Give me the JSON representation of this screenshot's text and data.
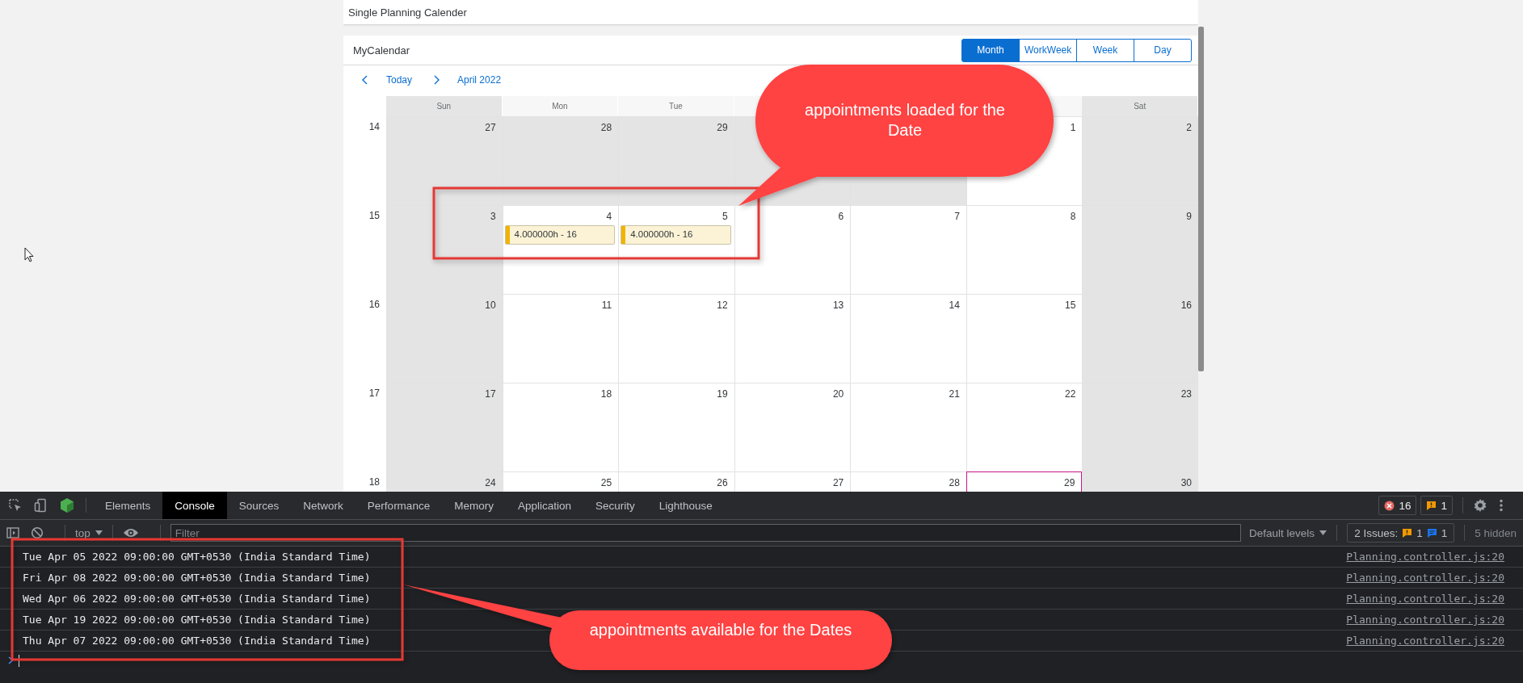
{
  "page_title": "Single Planning Calender",
  "calendar": {
    "title": "MyCalendar",
    "views": [
      {
        "label": "Month",
        "selected": true
      },
      {
        "label": "WorkWeek",
        "selected": false
      },
      {
        "label": "Week",
        "selected": false
      },
      {
        "label": "Day",
        "selected": false
      }
    ],
    "nav": {
      "today": "Today",
      "period": "April 2022"
    },
    "day_headers": [
      {
        "label": "Sun",
        "weekend": true
      },
      {
        "label": "Mon",
        "weekend": false
      },
      {
        "label": "Tue",
        "weekend": false
      },
      {
        "label": "Sat",
        "weekend": true
      }
    ],
    "weeks": [
      {
        "number": "14",
        "days": [
          {
            "day": "27",
            "muted": true,
            "today": false
          },
          {
            "day": "28",
            "muted": true,
            "today": false
          },
          {
            "day": "29",
            "muted": true,
            "today": false
          },
          {
            "muted": true,
            "today": false
          },
          {
            "muted": true,
            "today": false
          },
          {
            "day": "1",
            "muted": false,
            "today": false
          },
          {
            "day": "2",
            "muted": true,
            "today": false
          }
        ]
      },
      {
        "number": "15",
        "days": [
          {
            "day": "3",
            "muted": true,
            "today": false
          },
          {
            "day": "4",
            "muted": false,
            "today": false,
            "appointments": [
              {
                "title": "4.000000h - 16",
                "color": "#f0b400"
              }
            ]
          },
          {
            "day": "5",
            "muted": false,
            "today": false,
            "appointments": [
              {
                "title": "4.000000h - 16",
                "color": "#f0b400"
              }
            ]
          },
          {
            "day": "6",
            "muted": false,
            "today": false
          },
          {
            "day": "7",
            "muted": false,
            "today": false
          },
          {
            "day": "8",
            "muted": false,
            "today": false
          },
          {
            "day": "9",
            "muted": true,
            "today": false
          }
        ]
      },
      {
        "number": "16",
        "days": [
          {
            "day": "10",
            "muted": true,
            "today": false
          },
          {
            "day": "11",
            "muted": false,
            "today": false
          },
          {
            "day": "12",
            "muted": false,
            "today": false
          },
          {
            "day": "13",
            "muted": false,
            "today": false
          },
          {
            "day": "14",
            "muted": false,
            "today": false
          },
          {
            "day": "15",
            "muted": false,
            "today": false
          },
          {
            "day": "16",
            "muted": true,
            "today": false
          }
        ]
      },
      {
        "number": "17",
        "days": [
          {
            "day": "17",
            "muted": true,
            "today": false
          },
          {
            "day": "18",
            "muted": false,
            "today": false
          },
          {
            "day": "19",
            "muted": false,
            "today": false
          },
          {
            "day": "20",
            "muted": false,
            "today": false
          },
          {
            "day": "21",
            "muted": false,
            "today": false
          },
          {
            "day": "22",
            "muted": false,
            "today": false
          },
          {
            "day": "23",
            "muted": true,
            "today": false
          }
        ]
      },
      {
        "number": "18",
        "days": [
          {
            "day": "24",
            "muted": true,
            "today": false
          },
          {
            "day": "25",
            "muted": false,
            "today": false
          },
          {
            "day": "26",
            "muted": false,
            "today": false
          },
          {
            "day": "27",
            "muted": false,
            "today": false
          },
          {
            "day": "28",
            "muted": false,
            "today": false
          },
          {
            "day": "29",
            "muted": false,
            "today": true
          },
          {
            "day": "30",
            "muted": true,
            "today": false
          }
        ]
      }
    ]
  },
  "callouts": [
    {
      "text": "appointments loaded for the Date"
    },
    {
      "text": "appointments available for the Dates"
    }
  ],
  "devtools": {
    "tabs": [
      {
        "label": "Elements",
        "selected": false
      },
      {
        "label": "Console",
        "selected": true
      },
      {
        "label": "Sources",
        "selected": false
      },
      {
        "label": "Network",
        "selected": false
      },
      {
        "label": "Performance",
        "selected": false
      },
      {
        "label": "Memory",
        "selected": false
      },
      {
        "label": "Application",
        "selected": false
      },
      {
        "label": "Security",
        "selected": false
      },
      {
        "label": "Lighthouse",
        "selected": false
      }
    ],
    "errors": "16",
    "warnings": "1",
    "context": "top",
    "filter_placeholder": "Filter",
    "levels": "Default levels",
    "issues": {
      "label": "2 Issues:",
      "warnings": "1",
      "messages": "1"
    },
    "hidden": "5 hidden",
    "logs": [
      {
        "message": "Tue Apr 05 2022 09:00:00 GMT+0530 (India Standard Time)",
        "source": "Planning.controller.js:20"
      },
      {
        "message": "Fri Apr 08 2022 09:00:00 GMT+0530 (India Standard Time)",
        "source": "Planning.controller.js:20"
      },
      {
        "message": "Wed Apr 06 2022 09:00:00 GMT+0530 (India Standard Time)",
        "source": "Planning.controller.js:20"
      },
      {
        "message": "Tue Apr 19 2022 09:00:00 GMT+0530 (India Standard Time)",
        "source": "Planning.controller.js:20"
      },
      {
        "message": "Thu Apr 07 2022 09:00:00 GMT+0530 (India Standard Time)",
        "source": "Planning.controller.js:20"
      }
    ]
  }
}
